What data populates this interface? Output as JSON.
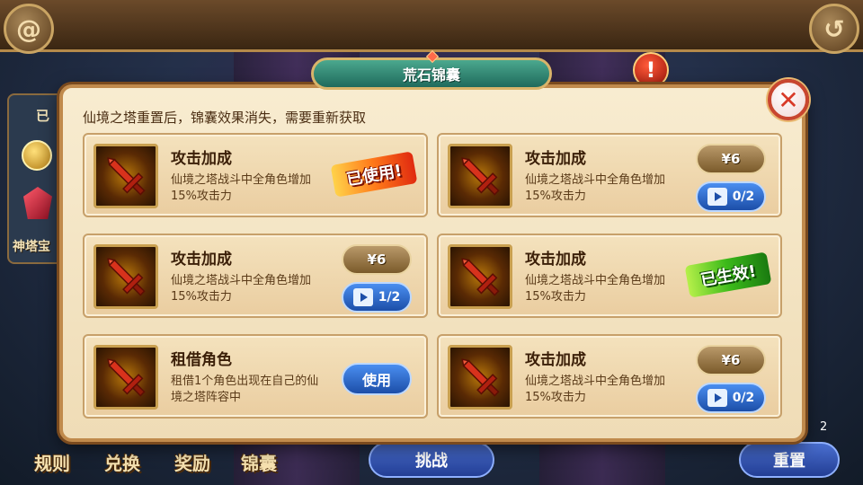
{
  "top": {
    "back_icon": "swirl-icon",
    "return_icon": "return-arrow-icon",
    "alert_symbol": "!"
  },
  "side": {
    "label": "已",
    "coin_icon": "coin-icon",
    "gem_icon": "gem-icon",
    "text": "神塔宝"
  },
  "dialog": {
    "title": "荒石锦囊",
    "close_symbol": "✕",
    "notice": "仙境之塔重置后，锦囊效果消失，需要重新获取",
    "cards": [
      {
        "title": "攻击加成",
        "desc": "仙境之塔战斗中全角色增加15%攻击力",
        "stamp": "已使用!",
        "status": "used"
      },
      {
        "title": "攻击加成",
        "desc": "仙境之塔战斗中全角色增加15%攻击力",
        "price": "¥6",
        "video": "0/2",
        "status": "buy"
      },
      {
        "title": "攻击加成",
        "desc": "仙境之塔战斗中全角色增加15%攻击力",
        "price": "¥6",
        "video": "1/2",
        "status": "buy"
      },
      {
        "title": "攻击加成",
        "desc": "仙境之塔战斗中全角色增加15%攻击力",
        "stamp": "已生效!",
        "status": "active"
      },
      {
        "title": "租借角色",
        "desc": "租借1个角色出现在自己的仙境之塔阵容中",
        "use": "使用",
        "status": "use"
      },
      {
        "title": "攻击加成",
        "desc": "仙境之塔战斗中全角色增加15%攻击力",
        "price": "¥6",
        "video": "0/2",
        "status": "buy"
      }
    ]
  },
  "bottom": {
    "tabs": [
      "规则",
      "兑换",
      "奖励",
      "锦囊"
    ],
    "challenge": "挑战",
    "reset": "重置",
    "count": "2"
  },
  "colors": {
    "dialog_bg": "#f8ecd0",
    "title_plate": "#1f6a5c",
    "blue_btn": "#1c4ea8",
    "used_stamp": "#e02a10",
    "active_stamp": "#3cba1a"
  }
}
